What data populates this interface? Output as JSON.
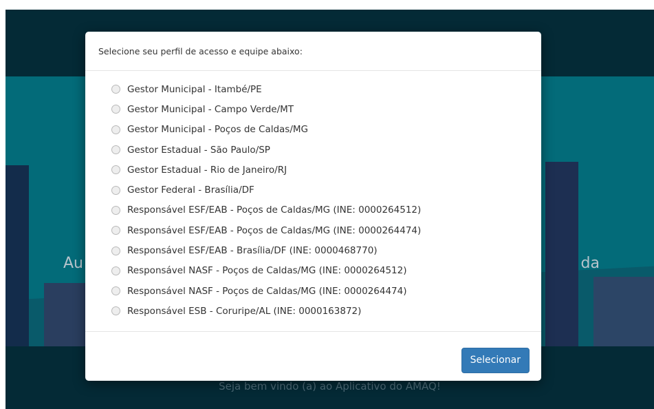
{
  "background": {
    "headline_left": "Au",
    "headline_right": "da",
    "welcome": "Seja bem vindo (a) ao Aplicativo do AMAQ!"
  },
  "modal": {
    "title": "Selecione seu perfil de acesso e equipe abaixo:",
    "options": [
      "Gestor Municipal - Itambé/PE",
      "Gestor Municipal - Campo Verde/MT",
      "Gestor Municipal - Poços de Caldas/MG",
      "Gestor Estadual - São Paulo/SP",
      "Gestor Estadual - Rio de Janeiro/RJ",
      "Gestor Federal - Brasília/DF",
      "Responsável ESF/EAB - Poços de Caldas/MG (INE: 0000264512)",
      "Responsável ESF/EAB - Poços de Caldas/MG (INE: 0000264474)",
      "Responsável ESF/EAB - Brasília/DF (INE: 0000468770)",
      "Responsável NASF - Poços de Caldas/MG (INE: 0000264512)",
      "Responsável NASF - Poços de Caldas/MG (INE: 0000264474)",
      "Responsável ESB - Coruripe/AL (INE: 0000163872)"
    ],
    "submit_label": "Selecionar"
  },
  "colors": {
    "primary_button": "#337ab7",
    "overlay_dark": "#042a36",
    "hero_teal": "#036b79"
  }
}
